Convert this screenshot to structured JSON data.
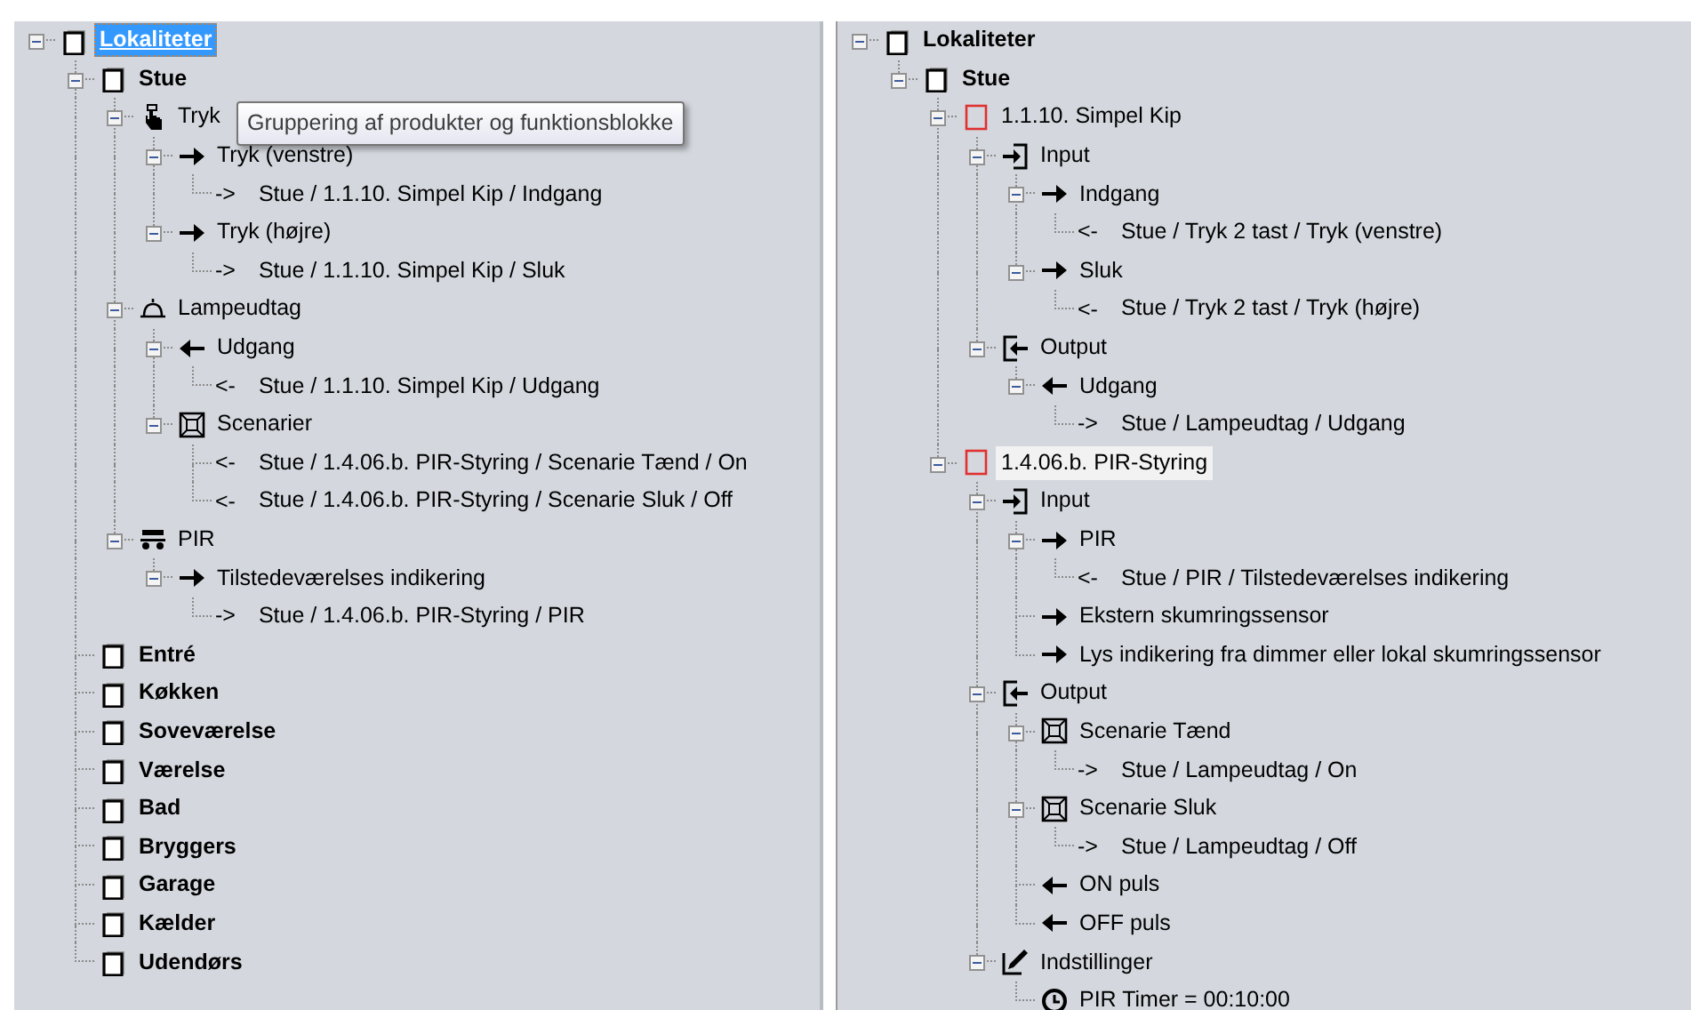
{
  "panes": [
    {
      "focused": true,
      "tree": [
        {
          "kind": "room",
          "label": "Lokaliteter",
          "selected": true,
          "expanded": true,
          "children": [
            {
              "kind": "room",
              "label": "Stue",
              "selected": false,
              "expanded": true,
              "children": [
                {
                  "kind": "group",
                  "label": "Tryk",
                  "selected": false,
                  "expanded": true,
                  "children": [
                    {
                      "kind": "arrow_right",
                      "label": "Tryk (venstre)",
                      "selected": false,
                      "expanded": true,
                      "children": [
                        {
                          "kind": "link",
                          "prefix": "->",
                          "label": "Stue / 1.1.10. Simpel Kip / Indgang",
                          "selected": false
                        }
                      ]
                    },
                    {
                      "kind": "arrow_right",
                      "label": "Tryk (højre)",
                      "selected": false,
                      "expanded": true,
                      "children": [
                        {
                          "kind": "link",
                          "prefix": "->",
                          "label": "Stue / 1.1.10. Simpel Kip / Sluk",
                          "selected": false
                        }
                      ]
                    }
                  ]
                },
                {
                  "kind": "lamp",
                  "label": "Lampeudtag",
                  "selected": false,
                  "expanded": true,
                  "children": [
                    {
                      "kind": "arrow_left",
                      "label": "Udgang",
                      "selected": false,
                      "expanded": true,
                      "children": [
                        {
                          "kind": "link",
                          "prefix": "<-",
                          "label": "Stue / 1.1.10. Simpel Kip / Udgang",
                          "selected": false
                        }
                      ]
                    },
                    {
                      "kind": "scene",
                      "label": "Scenarier",
                      "selected": false,
                      "expanded": true,
                      "children": [
                        {
                          "kind": "link",
                          "prefix": "<-",
                          "label": "Stue / 1.4.06.b.  PIR-Styring / Scenarie Tænd / On",
                          "selected": false
                        },
                        {
                          "kind": "link",
                          "prefix": "<-",
                          "label": "Stue / 1.4.06.b.  PIR-Styring / Scenarie Sluk / Off",
                          "selected": false
                        }
                      ]
                    }
                  ]
                },
                {
                  "kind": "auto",
                  "label": "PIR",
                  "selected": false,
                  "expanded": true,
                  "children": [
                    {
                      "kind": "arrow_right",
                      "label": "Tilstedeværelses indikering",
                      "selected": false,
                      "expanded": true,
                      "children": [
                        {
                          "kind": "link",
                          "prefix": "->",
                          "label": "Stue / 1.4.06.b.  PIR-Styring / PIR",
                          "selected": false
                        }
                      ]
                    }
                  ]
                }
              ]
            },
            {
              "kind": "room",
              "label": "Entré",
              "selected": false
            },
            {
              "kind": "room",
              "label": "Køkken",
              "selected": false
            },
            {
              "kind": "room",
              "label": "Soveværelse",
              "selected": false
            },
            {
              "kind": "room",
              "label": "Værelse",
              "selected": false
            },
            {
              "kind": "room",
              "label": "Bad",
              "selected": false
            },
            {
              "kind": "room",
              "label": "Bryggers",
              "selected": false
            },
            {
              "kind": "room",
              "label": "Garage",
              "selected": false
            },
            {
              "kind": "room",
              "label": "Kælder",
              "selected": false
            },
            {
              "kind": "room",
              "label": "Udendørs",
              "selected": false
            }
          ]
        }
      ],
      "tooltip": {
        "text": "Gruppering af produkter og funktionsblokke"
      }
    },
    {
      "focused": false,
      "tree": [
        {
          "kind": "room",
          "label": "Lokaliteter",
          "selected": false,
          "expanded": true,
          "children": [
            {
              "kind": "room",
              "label": "Stue",
              "selected": false,
              "expanded": true,
              "children": [
                {
                  "kind": "block",
                  "label": "1.1.10. Simpel Kip",
                  "selected": false,
                  "expanded": true,
                  "children": [
                    {
                      "kind": "input",
                      "label": "Input",
                      "selected": false,
                      "expanded": true,
                      "children": [
                        {
                          "kind": "arrow_right",
                          "label": "Indgang",
                          "selected": false,
                          "expanded": true,
                          "children": [
                            {
                              "kind": "link",
                              "prefix": "<-",
                              "label": "Stue / Tryk 2 tast / Tryk (venstre)",
                              "selected": false
                            }
                          ]
                        },
                        {
                          "kind": "arrow_right",
                          "label": "Sluk",
                          "selected": false,
                          "expanded": true,
                          "children": [
                            {
                              "kind": "link",
                              "prefix": "<-",
                              "label": "Stue / Tryk 2 tast / Tryk (højre)",
                              "selected": false
                            }
                          ]
                        }
                      ]
                    },
                    {
                      "kind": "output",
                      "label": "Output",
                      "selected": false,
                      "expanded": true,
                      "children": [
                        {
                          "kind": "arrow_left",
                          "label": "Udgang",
                          "selected": false,
                          "expanded": true,
                          "children": [
                            {
                              "kind": "link",
                              "prefix": "->",
                              "label": "Stue / Lampeudtag / Udgang",
                              "selected": false
                            }
                          ]
                        }
                      ]
                    }
                  ]
                },
                {
                  "kind": "block",
                  "label": "1.4.06.b.  PIR-Styring",
                  "selected": true,
                  "expanded": true,
                  "children": [
                    {
                      "kind": "input",
                      "label": "Input",
                      "selected": false,
                      "expanded": true,
                      "children": [
                        {
                          "kind": "arrow_right",
                          "label": "PIR",
                          "selected": false,
                          "expanded": true,
                          "children": [
                            {
                              "kind": "link",
                              "prefix": "<-",
                              "label": "Stue / PIR / Tilstedeværelses indikering",
                              "selected": false
                            }
                          ]
                        },
                        {
                          "kind": "arrow_right",
                          "label": "Ekstern skumringssensor",
                          "selected": false
                        },
                        {
                          "kind": "arrow_right",
                          "label": "Lys indikering fra dimmer eller lokal skumringssensor",
                          "selected": false
                        }
                      ]
                    },
                    {
                      "kind": "output",
                      "label": "Output",
                      "selected": false,
                      "expanded": true,
                      "children": [
                        {
                          "kind": "scene",
                          "label": "Scenarie Tænd",
                          "selected": false,
                          "expanded": true,
                          "children": [
                            {
                              "kind": "link",
                              "prefix": "->",
                              "label": "Stue / Lampeudtag / On",
                              "selected": false
                            }
                          ]
                        },
                        {
                          "kind": "scene",
                          "label": "Scenarie Sluk",
                          "selected": false,
                          "expanded": true,
                          "children": [
                            {
                              "kind": "link",
                              "prefix": "->",
                              "label": "Stue / Lampeudtag / Off",
                              "selected": false
                            }
                          ]
                        },
                        {
                          "kind": "arrow_left",
                          "label": "ON puls",
                          "selected": false
                        },
                        {
                          "kind": "arrow_left",
                          "label": "OFF puls",
                          "selected": false
                        }
                      ]
                    },
                    {
                      "kind": "settings",
                      "label": "Indstillinger",
                      "selected": false,
                      "expanded": true,
                      "children": [
                        {
                          "kind": "clock",
                          "label": "PIR Timer = 00:10:00",
                          "selected": false
                        }
                      ]
                    }
                  ]
                }
              ]
            }
          ]
        }
      ]
    }
  ]
}
